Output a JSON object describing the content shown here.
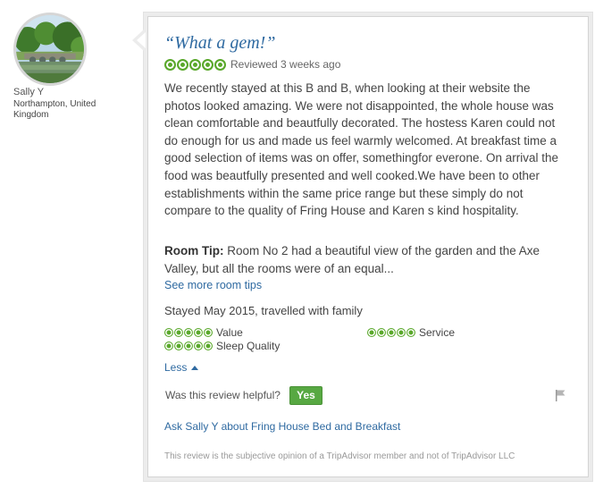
{
  "reviewer": {
    "name": "Sally Y",
    "location": "Northampton, United Kingdom"
  },
  "review": {
    "title": "“What a gem!”",
    "rating_bubbles": 5,
    "reviewed_date": "Reviewed 3 weeks ago",
    "body": "We recently stayed at this B and B, when looking at their website the photos looked amazing. We were not disappointed, the whole house was clean comfortable and beautfully decorated. The hostess Karen could not do enough for us and made us feel warmly welcomed. At breakfast time a good selection of items was on offer, somethingfor everone. On arrival the food was beautfully presented and well cooked.We have been to other establishments within the same price range but these simply do not compare to the quality of Fring House and Karen s kind hospitality.",
    "room_tip_label": "Room Tip:",
    "room_tip_text": "Room No 2 had a beautiful view of the garden and the Axe Valley, but all the rooms were of an equal...",
    "see_more_room_tips": "See more room tips",
    "stayed": "Stayed May 2015, travelled with family",
    "subratings": [
      {
        "label": "Value",
        "bubbles": 5
      },
      {
        "label": "Service",
        "bubbles": 5
      },
      {
        "label": "Sleep Quality",
        "bubbles": 5
      }
    ],
    "less_label": "Less",
    "helpful_question": "Was this review helpful?",
    "yes_label": "Yes",
    "ask_link": "Ask Sally Y about Fring House Bed and Breakfast",
    "disclaimer": "This review is the subjective opinion of a TripAdvisor member and not of TripAdvisor LLC"
  },
  "colors": {
    "link": "#2f6aa1",
    "bubble_green": "#5aa82b",
    "yes_button": "#57a842"
  },
  "icons": {
    "flag": "flag-icon",
    "less_caret": "caret-up-icon",
    "avatar": "avatar"
  }
}
